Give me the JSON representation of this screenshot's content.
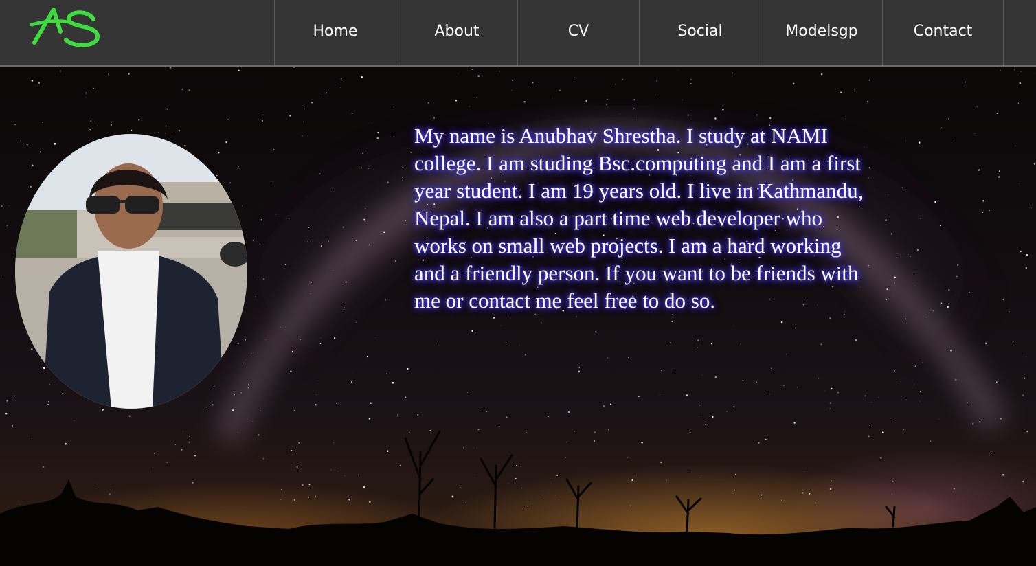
{
  "header": {
    "logo_text": "AS",
    "nav": [
      {
        "label": "Home"
      },
      {
        "label": "About"
      },
      {
        "label": "CV"
      },
      {
        "label": "Social"
      },
      {
        "label": "Modelsgp"
      },
      {
        "label": "Contact"
      }
    ]
  },
  "main": {
    "bio": "My name is Anubhav Shrestha. I study at NAMI college. I am studing Bsc.computing and I am a first year student. I am 19 years old. I live in Kathmandu, Nepal. I am also a part time web developer who works on small web projects. I am a hard working and a friendly person. If you want to be friends with me or contact me feel free to do so."
  },
  "colors": {
    "navbar": "#353535",
    "logo": "#3fdc3f",
    "nav_text": "#ffffff",
    "text_glow": "#3b2fd8"
  },
  "icons": {
    "logo": "as-monogram-logo",
    "profile": "profile-photo"
  }
}
